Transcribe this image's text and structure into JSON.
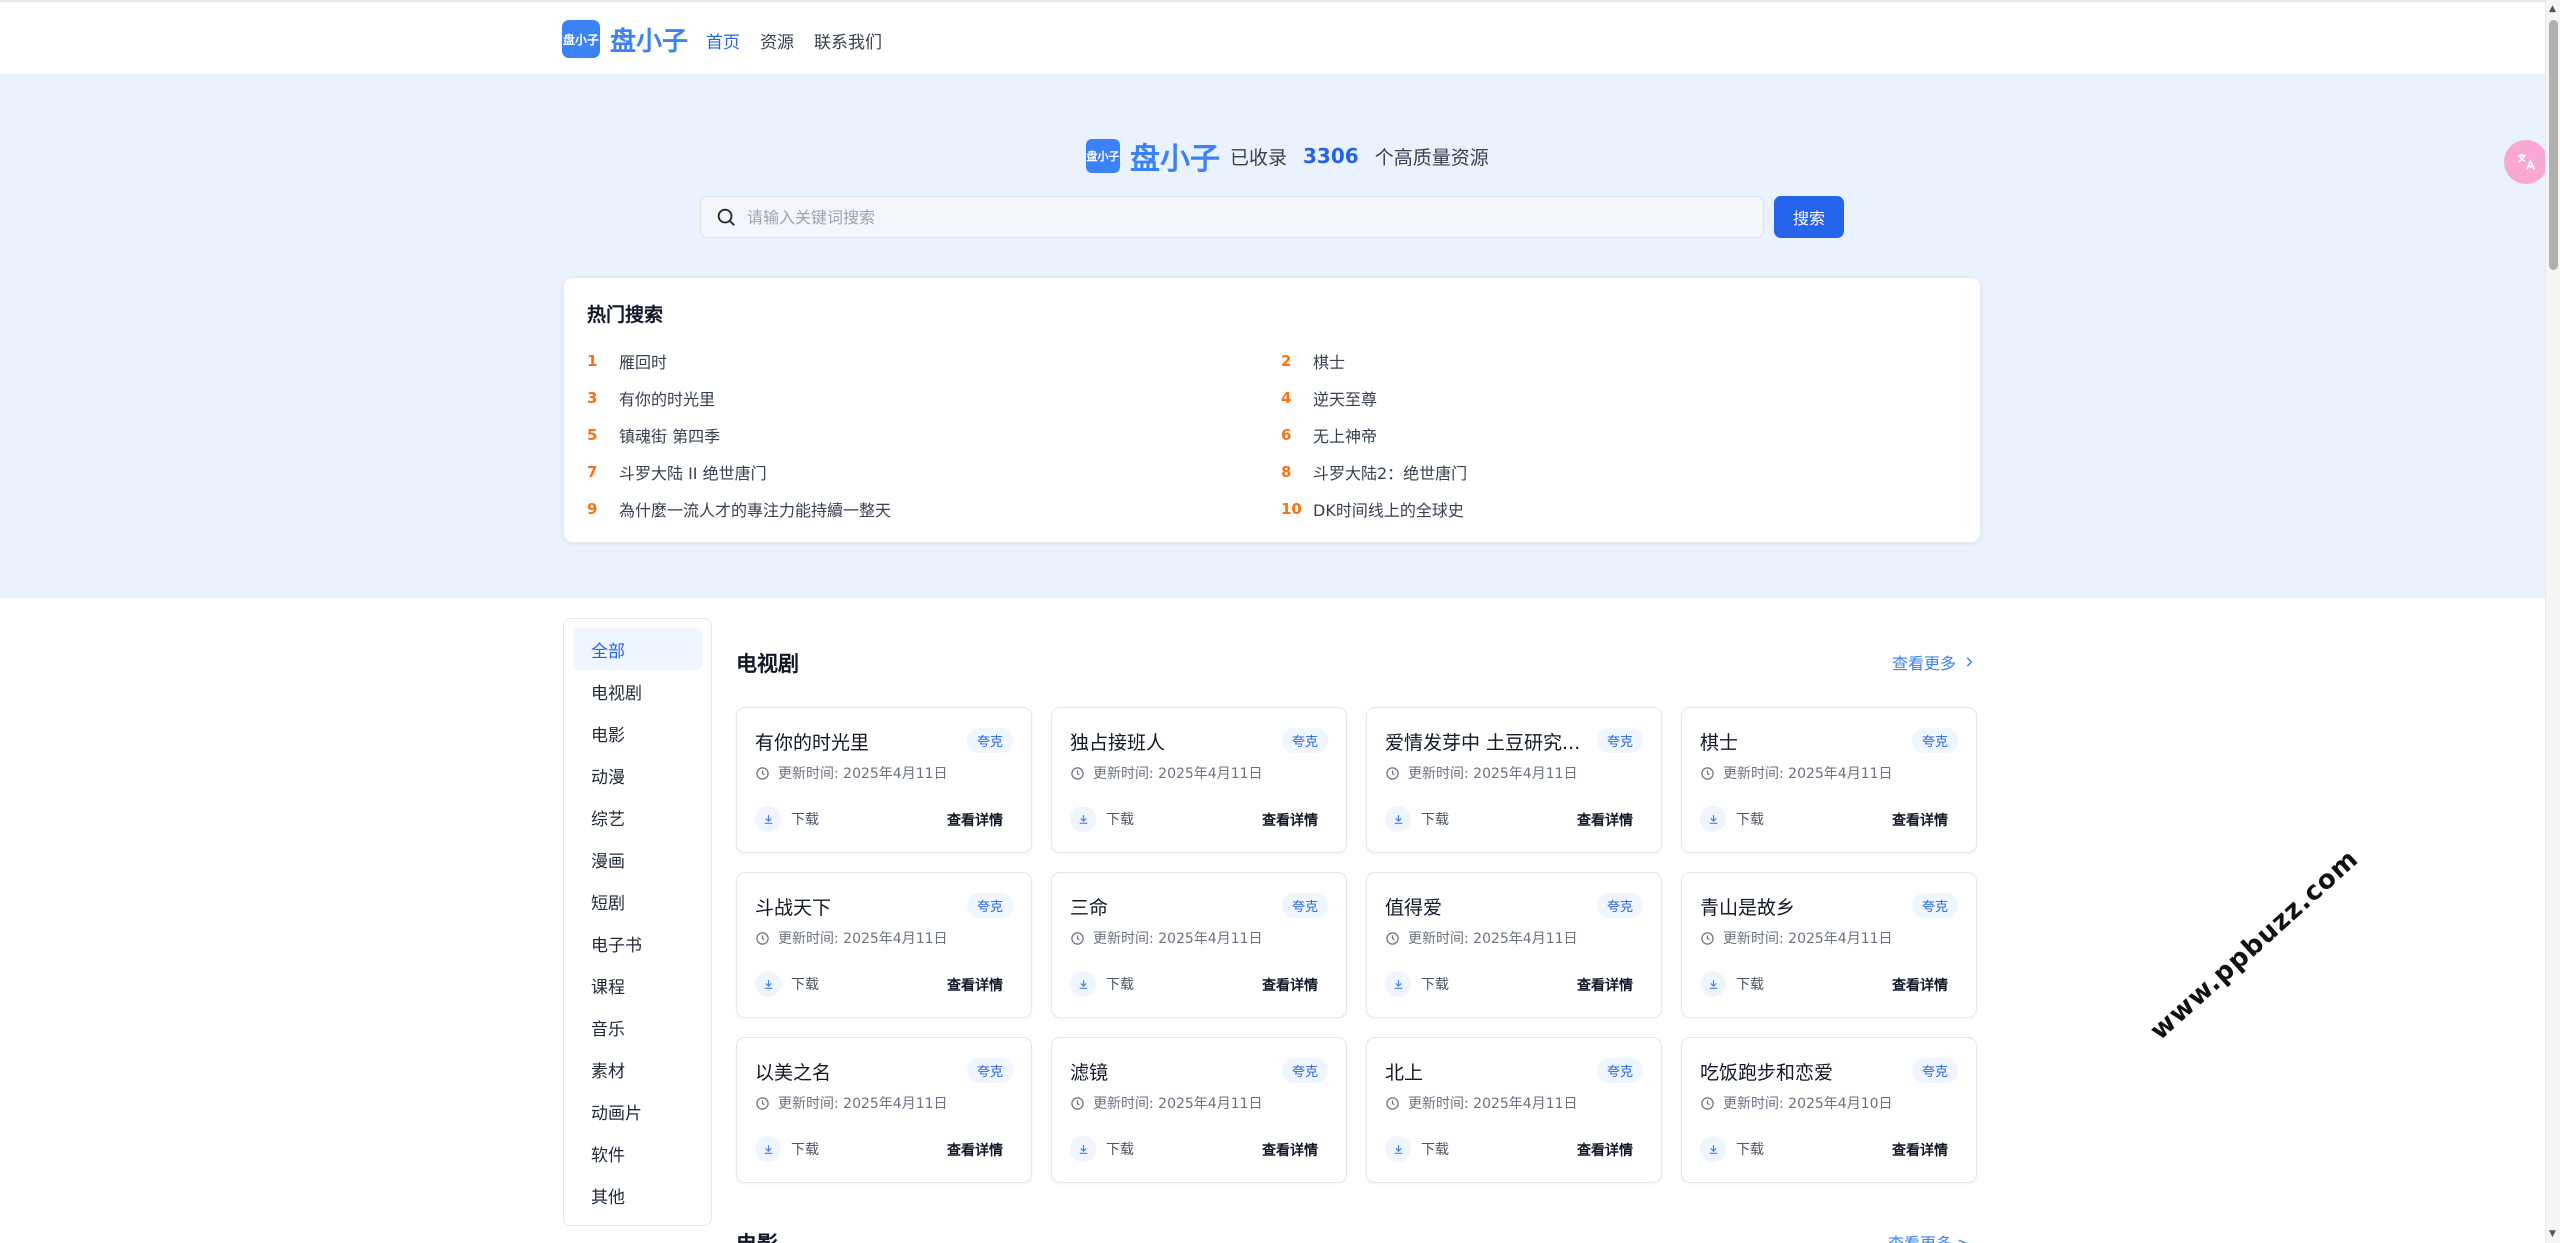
{
  "header": {
    "logo_text": "盘小子",
    "brand": "盘小子",
    "nav": [
      {
        "label": "首页",
        "active": true
      },
      {
        "label": "资源",
        "active": false
      },
      {
        "label": "联系我们",
        "active": false
      }
    ]
  },
  "hero": {
    "logo_text": "盘小子",
    "brand": "盘小子",
    "prefix": "已收录",
    "count": "3306",
    "suffix": "个高质量资源",
    "search_placeholder": "请输入关键词搜索",
    "search_button": "搜索"
  },
  "hot_search": {
    "title": "热门搜索",
    "items": [
      {
        "rank": "1",
        "text": "雁回时"
      },
      {
        "rank": "2",
        "text": "棋士"
      },
      {
        "rank": "3",
        "text": "有你的时光里"
      },
      {
        "rank": "4",
        "text": "逆天至尊"
      },
      {
        "rank": "5",
        "text": "镇魂街 第四季"
      },
      {
        "rank": "6",
        "text": "无上神帝"
      },
      {
        "rank": "7",
        "text": "斗罗大陆 II 绝世唐门"
      },
      {
        "rank": "8",
        "text": "斗罗大陆2：绝世唐门"
      },
      {
        "rank": "9",
        "text": "為什麼一流人才的專注力能持續一整天"
      },
      {
        "rank": "10",
        "text": "DK时间线上的全球史"
      }
    ]
  },
  "categories": [
    "全部",
    "电视剧",
    "电影",
    "动漫",
    "综艺",
    "漫画",
    "短剧",
    "电子书",
    "课程",
    "音乐",
    "素材",
    "动画片",
    "软件",
    "其他"
  ],
  "section": {
    "title": "电视剧",
    "more": "查看更多",
    "download_label": "下载",
    "detail_label": "查看详情",
    "cards": [
      {
        "title": "有你的时光里",
        "badge": "夸克",
        "time": "更新时间: 2025年4月11日"
      },
      {
        "title": "独占接班人",
        "badge": "夸克",
        "time": "更新时间: 2025年4月11日"
      },
      {
        "title": "爱情发芽中 土豆研究...",
        "badge": "夸克",
        "time": "更新时间: 2025年4月11日"
      },
      {
        "title": "棋士",
        "badge": "夸克",
        "time": "更新时间: 2025年4月11日"
      },
      {
        "title": "斗战天下",
        "badge": "夸克",
        "time": "更新时间: 2025年4月11日"
      },
      {
        "title": "三命",
        "badge": "夸克",
        "time": "更新时间: 2025年4月11日"
      },
      {
        "title": "值得爱",
        "badge": "夸克",
        "time": "更新时间: 2025年4月11日"
      },
      {
        "title": "青山是故乡",
        "badge": "夸克",
        "time": "更新时间: 2025年4月11日"
      },
      {
        "title": "以美之名",
        "badge": "夸克",
        "time": "更新时间: 2025年4月11日"
      },
      {
        "title": "滤镜",
        "badge": "夸克",
        "time": "更新时间: 2025年4月11日"
      },
      {
        "title": "北上",
        "badge": "夸克",
        "time": "更新时间: 2025年4月11日"
      },
      {
        "title": "吃饭跑步和恋爱",
        "badge": "夸克",
        "time": "更新时间: 2025年4月10日"
      }
    ]
  },
  "next_section": {
    "title": "电影",
    "more": "查看更多 >"
  },
  "watermark": "www.ppbuzz.com",
  "colors": {
    "accent": "#2563eb",
    "hero_bg": "#eaf2fd",
    "rank": "#f97316"
  }
}
